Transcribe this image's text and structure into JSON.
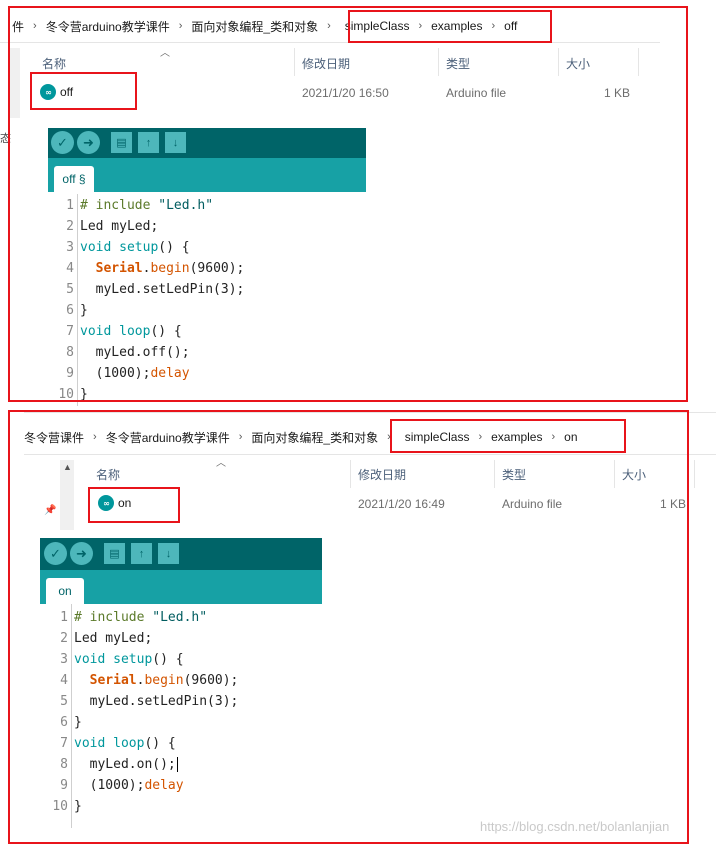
{
  "top_panel": {
    "breadcrumb": [
      "件",
      "冬令营arduino教学课件",
      "面向对象编程_类和对象",
      "simpleClass",
      "examples",
      "off"
    ],
    "columns": {
      "name": "名称",
      "date": "修改日期",
      "type": "类型",
      "size": "大小"
    },
    "file": {
      "name": "off",
      "date": "2021/1/20 16:50",
      "type": "Arduino file",
      "size": "1 KB",
      "icon": "arduino-icon"
    },
    "ide": {
      "tab_label": "off §",
      "toolbar": [
        {
          "name": "verify-icon",
          "glyph": "✓"
        },
        {
          "name": "upload-icon",
          "glyph": "➜"
        },
        {
          "name": "new-sketch-icon",
          "glyph": "▤"
        },
        {
          "name": "open-sketch-icon",
          "glyph": "↑"
        },
        {
          "name": "save-sketch-icon",
          "glyph": "↓"
        }
      ],
      "line_numbers": [
        "1",
        "2",
        "3",
        "4",
        "5",
        "6",
        "7",
        "8",
        "9",
        "10"
      ],
      "code": [
        {
          "comment": "# include ",
          "str": "\"Led.h\""
        },
        {
          "plain": "Led myLed;"
        },
        {
          "type": "void ",
          "type2": "setup",
          "plain": "() {"
        },
        {
          "indent": "  ",
          "obj": "Serial",
          "plain": ".",
          "fn": "begin",
          "plain2": "(9600);"
        },
        {
          "indent": "  ",
          "plain": "myLed.setLedPin(3);"
        },
        {
          "plain": "}"
        },
        {
          "type": "void ",
          "type2": "loop",
          "plain": "() {"
        },
        {
          "indent": "  ",
          "plain": "myLed.off();"
        },
        {
          "indent": "  ",
          "fn": "delay",
          "plain": "(1000);"
        },
        {
          "plain": "}"
        }
      ]
    },
    "left_edge_char": "态"
  },
  "bottom_panel": {
    "breadcrumb": [
      "冬令营课件",
      "冬令营arduino教学课件",
      "面向对象编程_类和对象",
      "simpleClass",
      "examples",
      "on"
    ],
    "columns": {
      "name": "名称",
      "date": "修改日期",
      "type": "类型",
      "size": "大小"
    },
    "file": {
      "name": "on",
      "date": "2021/1/20 16:49",
      "type": "Arduino file",
      "size": "1 KB",
      "icon": "arduino-icon"
    },
    "ide": {
      "tab_label": "on",
      "toolbar": [
        {
          "name": "verify-icon",
          "glyph": "✓"
        },
        {
          "name": "upload-icon",
          "glyph": "➜"
        },
        {
          "name": "new-sketch-icon",
          "glyph": "▤"
        },
        {
          "name": "open-sketch-icon",
          "glyph": "↑"
        },
        {
          "name": "save-sketch-icon",
          "glyph": "↓"
        }
      ],
      "line_numbers": [
        "1",
        "2",
        "3",
        "4",
        "5",
        "6",
        "7",
        "8",
        "9",
        "10"
      ],
      "code": [
        {
          "comment": "# include ",
          "str": "\"Led.h\""
        },
        {
          "plain": "Led myLed;"
        },
        {
          "type": "void ",
          "type2": "setup",
          "plain": "() {"
        },
        {
          "indent": "  ",
          "obj": "Serial",
          "plain": ".",
          "fn": "begin",
          "plain2": "(9600);"
        },
        {
          "indent": "  ",
          "plain": "myLed.setLedPin(3);"
        },
        {
          "plain": "}"
        },
        {
          "type": "void ",
          "type2": "loop",
          "plain": "() {"
        },
        {
          "indent": "  ",
          "plain": "myLed.on();"
        },
        {
          "indent": "  ",
          "fn": "delay",
          "plain": "(1000);"
        },
        {
          "plain": "}"
        }
      ]
    }
  },
  "watermark": "https://blog.csdn.net/bolanlanjian",
  "colors": {
    "annotation_red": "#e8141b",
    "ide_dark_teal": "#006468",
    "ide_teal": "#17a1a5",
    "ide_button": "#4db7bb",
    "arduino_icon": "#00979c"
  }
}
